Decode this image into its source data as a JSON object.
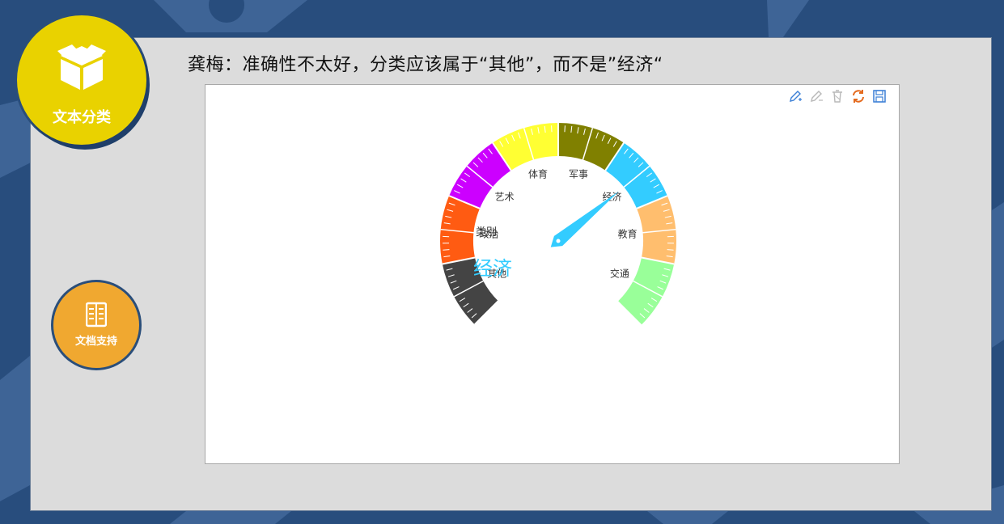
{
  "headline": "龚梅：准确性不太好，分类应该属于“其他”，而不是”经济“",
  "badges": {
    "main": {
      "label": "文本分类",
      "icon": "box-icon"
    },
    "doc": {
      "label": "文档支持",
      "icon": "book-icon"
    }
  },
  "toolbox": [
    {
      "name": "mark-pen-icon",
      "color": "#3b7fd6"
    },
    {
      "name": "clear-mark-icon",
      "color": "#b8b8b8"
    },
    {
      "name": "clear-icon",
      "color": "#b8b8b8"
    },
    {
      "name": "refresh-icon",
      "color": "#e46a1e"
    },
    {
      "name": "save-image-icon",
      "color": "#3b7fd6"
    }
  ],
  "chart_data": {
    "type": "gauge",
    "title": "类别",
    "value_label": "经济",
    "pointer_category": "经济",
    "categories": [
      {
        "label": "其他",
        "color": "#444444"
      },
      {
        "label": "政治",
        "color": "#ff5b12"
      },
      {
        "label": "艺术",
        "color": "#cc00ff"
      },
      {
        "label": "体育",
        "color": "#ffff33"
      },
      {
        "label": "军事",
        "color": "#808000"
      },
      {
        "label": "经济",
        "color": "#33ccff"
      },
      {
        "label": "教育",
        "color": "#ffbe6e"
      },
      {
        "label": "交通",
        "color": "#99ff99"
      }
    ]
  }
}
